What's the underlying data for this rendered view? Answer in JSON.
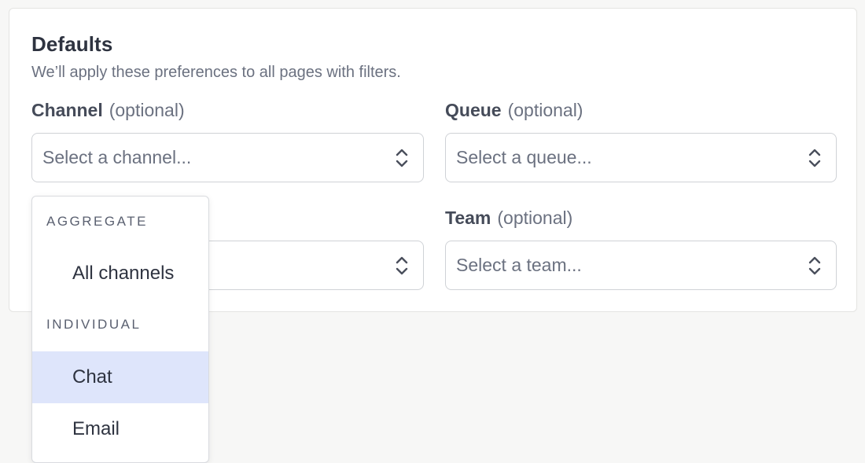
{
  "card": {
    "title": "Defaults",
    "subtitle": "We’ll apply these preferences to all pages with filters."
  },
  "fields": {
    "channel": {
      "label": "Channel",
      "optional": "(optional)",
      "placeholder": "Select a channel..."
    },
    "queue": {
      "label": "Queue",
      "optional": "(optional)",
      "placeholder": "Select a queue..."
    },
    "team": {
      "label": "Team",
      "optional": "(optional)",
      "placeholder": "Select a team..."
    }
  },
  "channel_menu": {
    "groups": [
      {
        "label": "AGGREGATE",
        "items": [
          "All channels"
        ]
      },
      {
        "label": "INDIVIDUAL",
        "items": [
          "Chat",
          "Email"
        ]
      }
    ],
    "highlighted": "Chat"
  },
  "colors": {
    "highlight": "#dee5fb",
    "text": "#2e3340",
    "muted": "#6b7180"
  },
  "icons": {
    "select_chevron": "chevron-up-down-icon"
  }
}
